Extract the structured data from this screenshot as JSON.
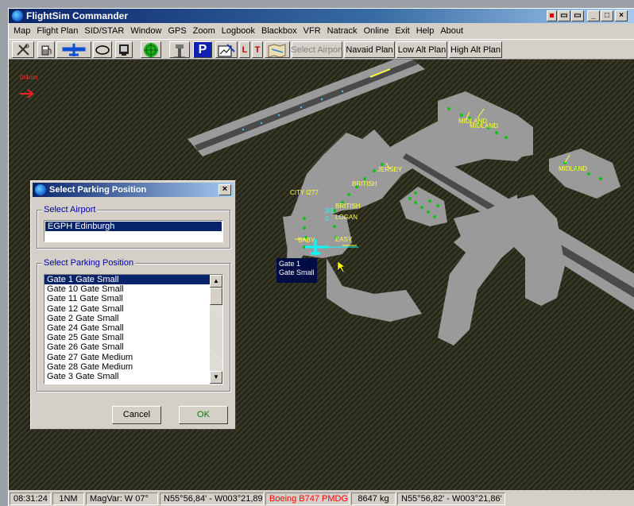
{
  "app": {
    "title": "FlightSim Commander"
  },
  "window_controls": [
    "▪",
    "▭",
    "▭",
    "_",
    "□",
    "×"
  ],
  "menu": [
    "Map",
    "Flight Plan",
    "SID/STAR",
    "Window",
    "GPS",
    "Zoom",
    "Logbook",
    "Blackbox",
    "VFR",
    "Natrack",
    "Online",
    "Exit",
    "Help",
    "About"
  ],
  "toolbar": {
    "l_label": "L",
    "t_label": "T",
    "p_label": "P",
    "select_airport": "Select Airport",
    "navaid_plan": "Navaid Plan",
    "low_alt_plan": "Low Alt Plan",
    "high_alt_plan": "High Alt Plan"
  },
  "map": {
    "scale": "0/4nm",
    "labels": {
      "midland1": "MIDLAND",
      "midland2": "MIDLAND",
      "midland3": "MIDLAND",
      "jersey": "JERSEY",
      "british1": "BRITISH",
      "city": "CITY I277",
      "british2": "BRITISH",
      "logan": "LOGAN",
      "baby": "BABY",
      "easy": "EASY",
      "small1": "2/3",
      "small2": "0"
    },
    "tooltip": {
      "line1": "Gate 1",
      "line2": "Gate Small"
    }
  },
  "dialog": {
    "title": "Select Parking Position",
    "close": "×",
    "airport_group": "Select Airport",
    "airport_value": "EGPH Edinburgh",
    "parking_group": "Select Parking Position",
    "parking_items": [
      "Gate 1  Gate Small",
      "Gate 10  Gate Small",
      "Gate 11  Gate Small",
      "Gate 12  Gate Small",
      "Gate 2  Gate Small",
      "Gate 24  Gate Small",
      "Gate 25  Gate Small",
      "Gate 26  Gate Small",
      "Gate 27  Gate Medium",
      "Gate 28  Gate Medium",
      "Gate 3  Gate Small"
    ],
    "cancel": "Cancel",
    "ok": "OK"
  },
  "status": {
    "time": "08:31:24",
    "range": "1NM",
    "magvar": "MagVar: W 07°",
    "position": "N55°56,84' - W003°21,89'",
    "aircraft": "Boeing B747 PMDG",
    "weight": "8647 kg",
    "cursor": "N55°56,82' - W003°21,86'"
  },
  "colors": {
    "aircraft_status": "#ff0000",
    "dialog_group_label": "#0000a8",
    "ok_button": "#008000",
    "map_label": "#ffff40"
  }
}
